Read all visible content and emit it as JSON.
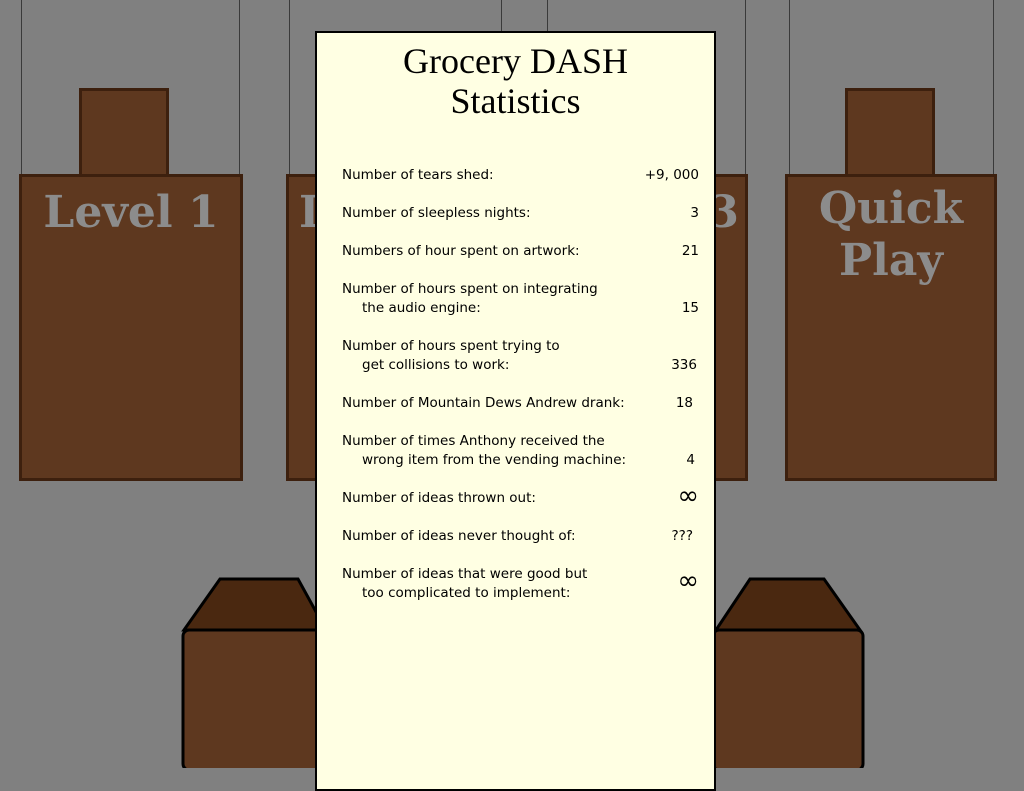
{
  "title_line1": "Grocery DASH",
  "title_line2": "Statistics",
  "boards": [
    {
      "label": "Level 1"
    },
    {
      "label": "L"
    },
    {
      "label": "3"
    },
    {
      "label_line1": "Quick",
      "label_line2": "Play"
    }
  ],
  "stats": [
    {
      "line1": "Number of tears shed:",
      "line2": "",
      "value": "+9, 000"
    },
    {
      "line1": "Number of sleepless nights:",
      "line2": "",
      "value": "3"
    },
    {
      "line1": "Numbers of hour spent on artwork:",
      "line2": "",
      "value": "21"
    },
    {
      "line1": "Number of hours spent on integrating",
      "line2": "the audio engine:",
      "value": "15"
    },
    {
      "line1": "Number of hours spent trying to",
      "line2": "get collisions to work:",
      "value": "336"
    },
    {
      "line1": "Number of Mountain Dews Andrew drank:",
      "line2": "",
      "value": "18"
    },
    {
      "line1": "Number of times Anthony received the",
      "line2": "wrong item from the vending machine:",
      "value": "4"
    },
    {
      "line1": "Number of ideas thrown out:",
      "line2": "",
      "value": "∞"
    },
    {
      "line1": "Number of ideas never thought of:",
      "line2": "",
      "value": "???"
    },
    {
      "line1": "Number of ideas that were good but",
      "line2": "too complicated to implement:",
      "value": "∞"
    }
  ],
  "colors": {
    "board": "#5e381f",
    "board_border": "#3d200e",
    "panel": "#ffffe3",
    "background": "#808080",
    "board_text": "#8c8c8c"
  }
}
